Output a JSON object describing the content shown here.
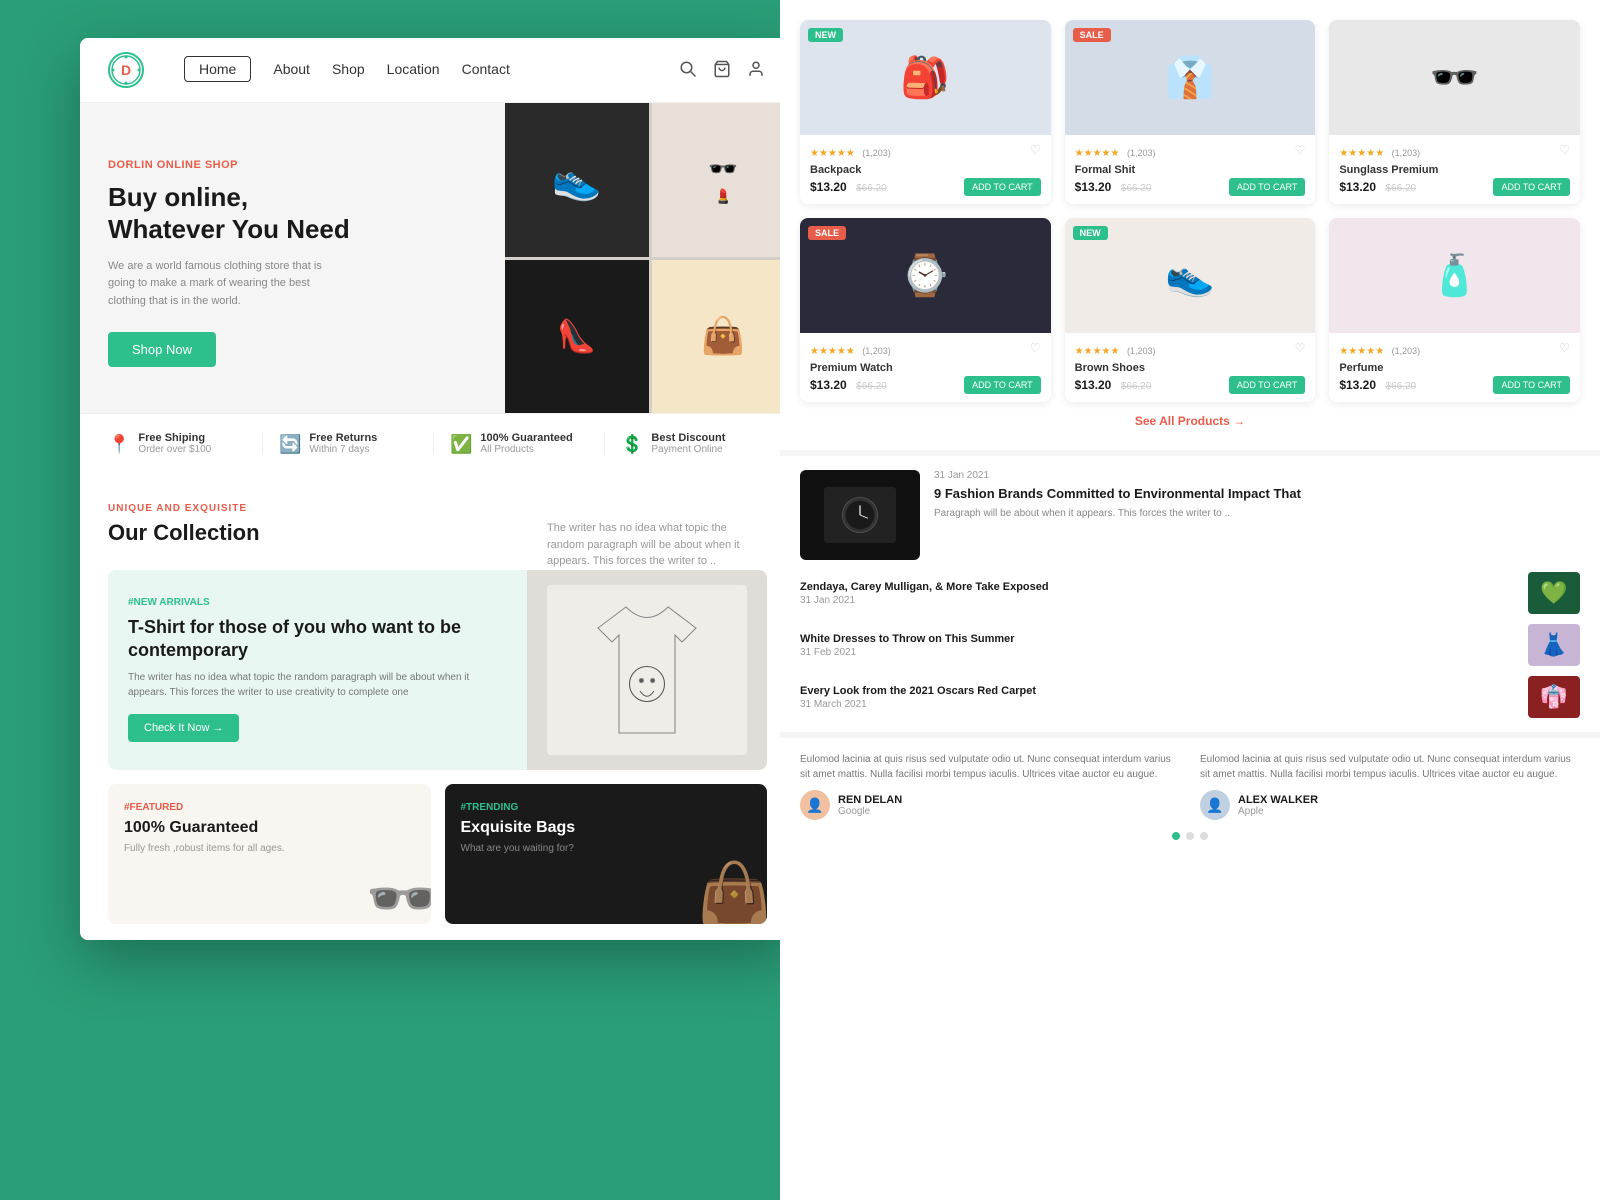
{
  "meta": {
    "title": "Dorlin Online Shop"
  },
  "navbar": {
    "logo_letter": "D",
    "nav_items": [
      {
        "label": "Home",
        "active": true
      },
      {
        "label": "About",
        "active": false
      },
      {
        "label": "Shop",
        "active": false
      },
      {
        "label": "Location",
        "active": false
      },
      {
        "label": "Contact",
        "active": false
      }
    ]
  },
  "hero": {
    "brand": "DORLIN ONLINE SHOP",
    "title_line1": "Buy online,",
    "title_line2": "Whatever You Need",
    "description": "We are a world famous clothing store that is going to make a mark of wearing the best clothing that is in the world.",
    "cta_label": "Shop Now"
  },
  "features": [
    {
      "icon": "📍",
      "title": "Free Shiping",
      "subtitle": "Order over $100"
    },
    {
      "icon": "🔄",
      "title": "Free Returns",
      "subtitle": "Within 7 days"
    },
    {
      "icon": "✓",
      "title": "100% Guaranteed",
      "subtitle": "All Products"
    },
    {
      "icon": "$",
      "title": "Best Discount",
      "subtitle": "Payment Online"
    }
  ],
  "collection": {
    "label": "UNIQUE AND EXQUISITE",
    "title": "Our Collection",
    "description": "The writer has no idea what topic the random paragraph will be about when it appears. This forces the writer to .."
  },
  "tshirt_card": {
    "tag": "#NEW ARRIVALS",
    "title": "T-Shirt for those of you who want to be contemporary",
    "description": "The writer has no idea what topic the random paragraph will be about when it appears. This forces the writer to use creativity to complete one",
    "cta": "Check It Now →"
  },
  "small_cards": [
    {
      "tag": "#FEATURED",
      "title": "100% Guaranteed",
      "description": "Fully fresh ,robust items for all ages."
    },
    {
      "tag": "#TRENDING",
      "title": "Exquisite Bags",
      "description": "What are you waiting for?"
    }
  ],
  "products": [
    {
      "name": "Backpack",
      "price": "$13.20",
      "old_price": "$66.20",
      "rating": "★★★★★",
      "rating_count": "(1,203)",
      "badge": "NEW",
      "badge_type": "new",
      "emoji": "🎒",
      "bg": "#dde4ee"
    },
    {
      "name": "Formal Shit",
      "price": "$13.20",
      "old_price": "$66.20",
      "rating": "★★★★★",
      "rating_count": "(1,203)",
      "badge": "SALE",
      "badge_type": "sale",
      "emoji": "👔",
      "bg": "#d4dce8"
    },
    {
      "name": "Sunglass Premium",
      "price": "$13.20",
      "old_price": "$66.20",
      "rating": "★★★★★",
      "rating_count": "(1,203)",
      "badge": "",
      "badge_type": "",
      "emoji": "🕶️",
      "bg": "#e8e8e8"
    },
    {
      "name": "Premium Watch",
      "price": "$13.20",
      "old_price": "$66.20",
      "rating": "★★★★★",
      "rating_count": "(1,203)",
      "badge": "SALE",
      "badge_type": "sale",
      "emoji": "⌚",
      "bg": "#2a2a3a"
    },
    {
      "name": "Brown Shoes",
      "price": "$13.20",
      "old_price": "$66.20",
      "rating": "★★★★★",
      "rating_count": "(1,203)",
      "badge": "NEW",
      "badge_type": "new",
      "emoji": "👟",
      "bg": "#f0ebe6"
    },
    {
      "name": "Perfume",
      "price": "$13.20",
      "old_price": "$66.20",
      "rating": "★★★★★",
      "rating_count": "(1,203)",
      "badge": "",
      "badge_type": "",
      "emoji": "🧴",
      "bg": "#f0e6ec"
    }
  ],
  "see_all": "See All Products →",
  "blog": {
    "featured": {
      "title": "9 Fashion Brands Committed to Environmental Impact That",
      "date": "31 Jan 2021",
      "excerpt": "Paragraph will be about when it appears. This forces the writer to ..",
      "emoji": "🖤"
    },
    "items": [
      {
        "title": "Zendaya, Carey Mulligan, & More Take Exposed",
        "date": "31 Jan 2021",
        "emoji": "💚",
        "bg": "#1a5c3a"
      },
      {
        "title": "White Dresses to Throw on This Summer",
        "date": "31 Feb 2021",
        "emoji": "👗",
        "bg": "#c8b4d4"
      },
      {
        "title": "Every Look from the 2021 Oscars Red Carpet",
        "date": "31 March 2021",
        "emoji": "👘",
        "bg": "#8b2020"
      }
    ]
  },
  "testimonials": [
    {
      "text": "Eulomod lacinia at quis risus sed vulputate odio ut. Nunc consequat interdum varius sit amet mattis. Nulla facilisi morbi tempus iaculis. Ultrices vitae auctor eu augue.",
      "author": "REN DELAN",
      "company": "Google",
      "avatar": "👤"
    },
    {
      "text": "Eulomod lacinia at quis risus sed vulputate odio ut. Nunc consequat interdum varius sit amet mattis. Nulla facilisi morbi tempus iaculis. Ultrices vitae auctor eu augue.",
      "author": "ALEX WALKER",
      "company": "Apple",
      "avatar": "👤"
    }
  ],
  "labels": {
    "add_to_cart": "ADD TO CART",
    "check_it_now": "Check It Now →"
  }
}
